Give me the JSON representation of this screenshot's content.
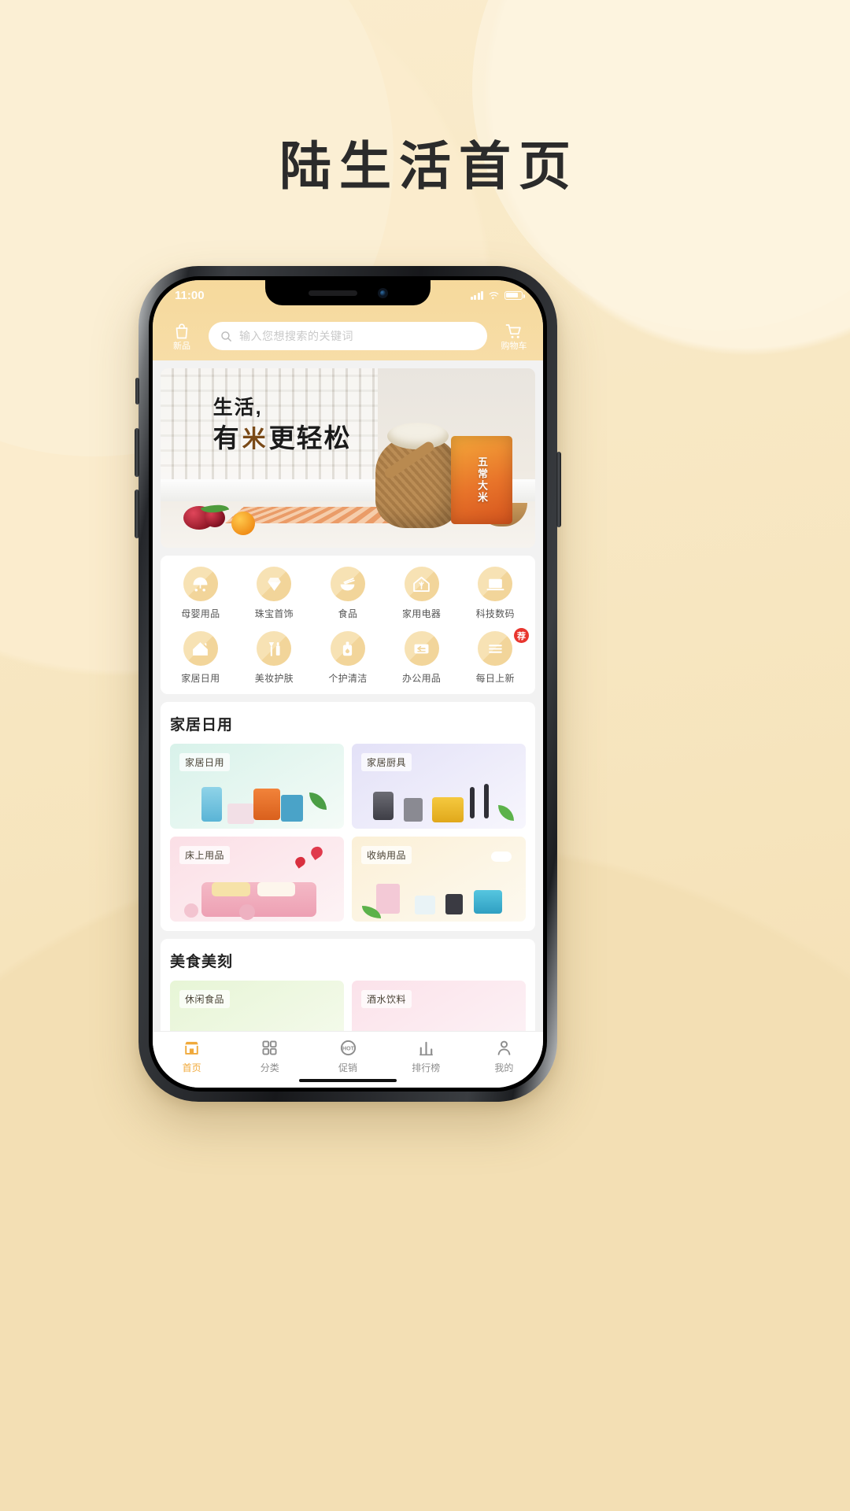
{
  "page": {
    "hero_title": "陆生活首页"
  },
  "status_bar": {
    "time": "11:00",
    "signal_icon": "signal-bars-icon",
    "wifi_icon": "wifi-icon",
    "battery_icon": "battery-icon"
  },
  "header": {
    "new_label": "新品",
    "new_icon": "shopping-bag-icon",
    "search_icon": "search-icon",
    "search_placeholder": "输入您想搜索的关键词",
    "search_value": "",
    "cart_label": "购物车",
    "cart_icon": "shopping-cart-icon"
  },
  "banner": {
    "line1": "生活,",
    "line2_a": "有",
    "line2_mi": "米",
    "line2_b": "更轻松",
    "package_text": "五常大米"
  },
  "categories": {
    "row1": [
      {
        "label": "母婴用品",
        "icon": "stroller-icon"
      },
      {
        "label": "珠宝首饰",
        "icon": "diamond-icon"
      },
      {
        "label": "食品",
        "icon": "noodle-bowl-icon"
      },
      {
        "label": "家用电器",
        "icon": "home-appliance-icon"
      },
      {
        "label": "科技数码",
        "icon": "laptop-icon"
      }
    ],
    "row2": [
      {
        "label": "家居日用",
        "icon": "house-icon"
      },
      {
        "label": "美妆护肤",
        "icon": "cosmetics-icon"
      },
      {
        "label": "个护清洁",
        "icon": "lotion-bottle-icon"
      },
      {
        "label": "办公用品",
        "icon": "envelope-icon"
      },
      {
        "label": "每日上新",
        "icon": "list-icon",
        "badge": "荐"
      }
    ]
  },
  "sections": [
    {
      "title": "家居日用",
      "tiles": [
        {
          "tag": "家居日用",
          "bg_start": "#d8f2ea",
          "bg_end": "#f4fbf7"
        },
        {
          "tag": "家居厨具",
          "bg_start": "#e3e1f7",
          "bg_end": "#f7f6fd"
        },
        {
          "tag": "床上用品",
          "bg_start": "#fbdfe6",
          "bg_end": "#fdf3f5"
        },
        {
          "tag": "收纳用品",
          "bg_start": "#fbf0d7",
          "bg_end": "#fdf9ef"
        }
      ]
    },
    {
      "title": "美食美刻",
      "tiles": [
        {
          "tag": "休闲食品",
          "bg_start": "#e7f5d6",
          "bg_end": "#f6fbee"
        },
        {
          "tag": "酒水饮料",
          "bg_start": "#fbe2ea",
          "bg_end": "#fdf4f7"
        }
      ]
    }
  ],
  "tabbar": [
    {
      "label": "首页",
      "icon": "home-shop-icon",
      "active": true
    },
    {
      "label": "分类",
      "icon": "grid-icon",
      "active": false
    },
    {
      "label": "促销",
      "icon": "hot-promo-icon",
      "active": false
    },
    {
      "label": "排行榜",
      "icon": "ranking-bars-icon",
      "active": false
    },
    {
      "label": "我的",
      "icon": "user-icon",
      "active": false
    }
  ],
  "colors": {
    "brand": "#f0a93b",
    "header_bg": "#f6d99c",
    "badge_red": "#e8352e"
  }
}
